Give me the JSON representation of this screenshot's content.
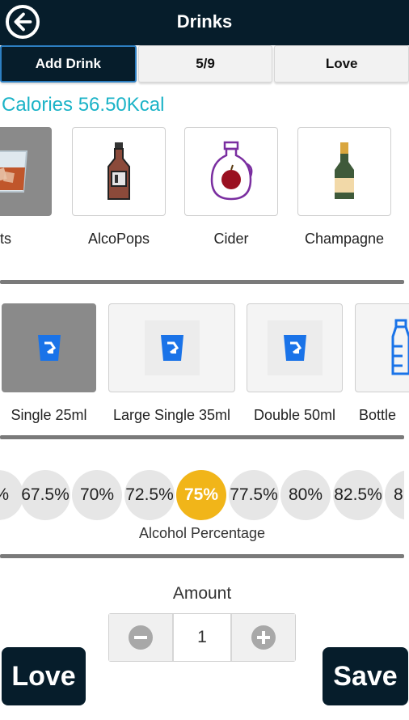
{
  "header": {
    "title": "Drinks",
    "back_icon": "arrow-left-icon"
  },
  "tabs": [
    {
      "label": "Add Drink",
      "active": true
    },
    {
      "label": "5/9",
      "active": false
    },
    {
      "label": "Love",
      "active": false
    }
  ],
  "calories": {
    "text": "Calories 56.50Kcal",
    "color": "#1bb3c7"
  },
  "drink_types": [
    {
      "label": "irits",
      "icon": "spirits-glass-icon",
      "selected": true
    },
    {
      "label": "AlcoPops",
      "icon": "bottle-icon",
      "selected": false
    },
    {
      "label": "Cider",
      "icon": "cider-jug-icon",
      "selected": false
    },
    {
      "label": "Champagne",
      "icon": "champagne-bottle-icon",
      "selected": false
    }
  ],
  "sizes": [
    {
      "label": "Single 25ml",
      "icon": "shot-glass-icon",
      "selected": true
    },
    {
      "label": "Large Single 35ml",
      "icon": "shot-glass-icon",
      "selected": false
    },
    {
      "label": "Double 50ml",
      "icon": "shot-glass-icon",
      "selected": false
    },
    {
      "label": "Bottle",
      "icon": "bottle-icon",
      "selected": false
    }
  ],
  "percentages": {
    "values": [
      "%",
      "67.5%",
      "70%",
      "72.5%",
      "75%",
      "77.5%",
      "80%",
      "82.5%",
      "8"
    ],
    "selected": "75%",
    "label": "Alcohol Percentage",
    "accent": "#f1b519"
  },
  "amount": {
    "label": "Amount",
    "value": "1",
    "minus_icon": "minus-circle-icon",
    "plus_icon": "plus-circle-icon"
  },
  "footer": {
    "love_label": "Love",
    "save_label": "Save"
  },
  "colors": {
    "brand_dark": "#061d2b",
    "glass_blue": "#1a73e8"
  }
}
